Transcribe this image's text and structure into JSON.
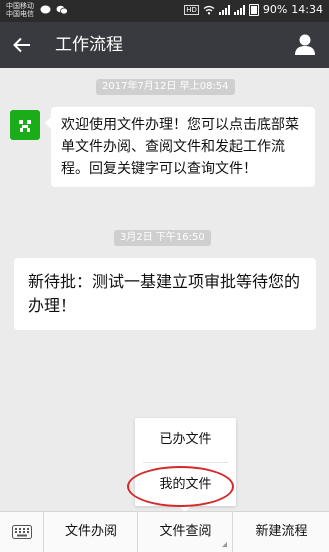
{
  "status_bar": {
    "carrier_1": "中国移动",
    "carrier_2": "中国电信",
    "network_badge": "HD",
    "battery": "90%",
    "time": "14:34"
  },
  "header": {
    "title": "工作流程",
    "back_icon": "arrow-left-icon",
    "profile_icon": "person-icon"
  },
  "chat": {
    "timestamp_1": "2017年7月12日 早上08:54",
    "message_1": "欢迎使用文件办理！您可以点击底部菜单文件办阅、查阅文件和发起工作流程。回复关键字可以查询文件！",
    "timestamp_2": "3月2日 下午16:50",
    "message_2": "新待批：测试一基建立项审批等待您的办理！"
  },
  "popup_menu": {
    "items": [
      "已办文件",
      "我的文件"
    ],
    "highlighted_item": "我的文件",
    "highlight_color": "#d42a2a"
  },
  "bottom_menu": {
    "keyboard_icon": "keyboard-icon",
    "items": [
      "文件办阅",
      "文件查阅",
      "新建流程"
    ]
  },
  "colors": {
    "titlebar": "#393a3f",
    "avatar": "#1aad19",
    "background": "#ebebeb"
  }
}
